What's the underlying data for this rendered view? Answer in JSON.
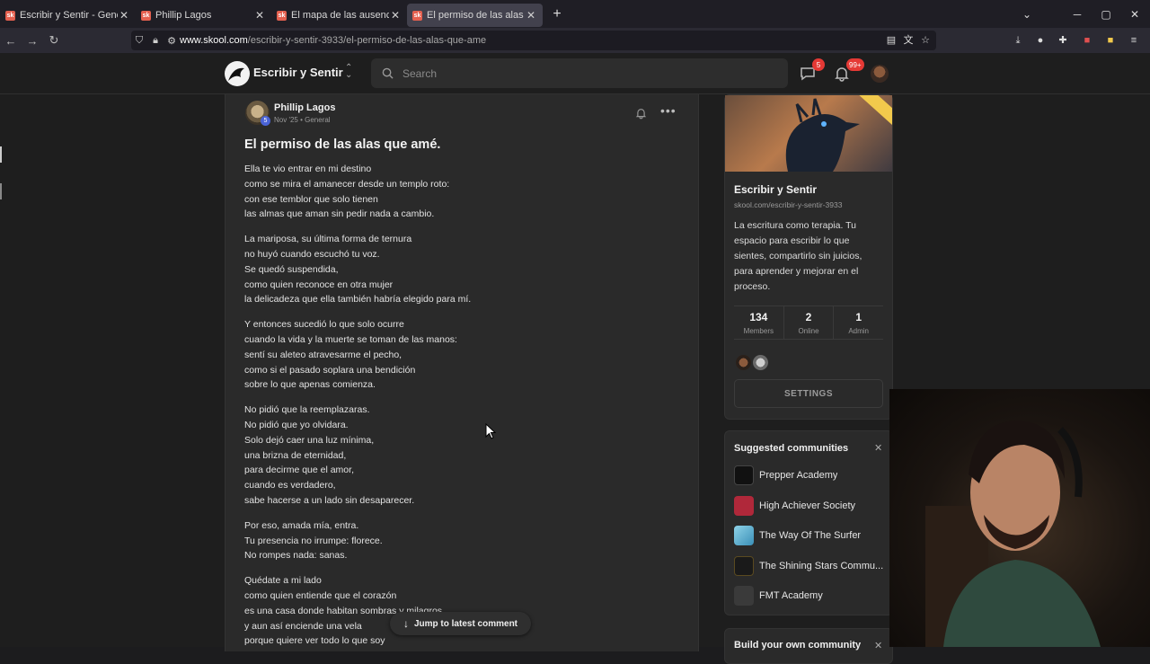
{
  "browser": {
    "tabs": [
      {
        "title": "Escribir y Sentir - General",
        "active": false
      },
      {
        "title": "Phillip Lagos",
        "active": false
      },
      {
        "title": "El mapa de las ausencias I - Escr",
        "active": false
      },
      {
        "title": "El permiso de las alas que amé.",
        "active": true
      }
    ],
    "favicon_text": "sk",
    "url_host": "www.skool.com",
    "url_path": "/escribir-y-sentir-3933/el-permiso-de-las-alas-que-ame"
  },
  "topnav": {
    "brand": "Escribir y Sentir",
    "search_placeholder": "Search",
    "chat_badge": "5",
    "notif_badge": "99+"
  },
  "post": {
    "author": "Phillip Lagos",
    "level": "5",
    "meta": "Nov '25 • General",
    "title": "El permiso de las alas que amé.",
    "stanzas": [
      [
        "Ella te vio entrar en mi destino",
        "como se mira el amanecer desde un templo roto:",
        "con ese temblor que solo tienen",
        "las almas que aman sin pedir nada a cambio."
      ],
      [
        "La mariposa, su última forma de ternura",
        "no huyó cuando escuchó tu voz.",
        "Se quedó suspendida,",
        "como quien reconoce en otra mujer",
        "la delicadeza que ella también habría elegido para mí."
      ],
      [
        "Y entonces sucedió lo que solo ocurre",
        "cuando la vida y la muerte se toman de las manos:",
        "sentí su aleteo atravesarme el pecho,",
        "como si el pasado soplara una bendición",
        "sobre lo que apenas comienza."
      ],
      [
        "No pidió que la reemplazaras.",
        "No pidió que yo olvidara.",
        "Solo dejó caer una luz mínima,",
        "una brizna de eternidad,",
        "para decirme que el amor,",
        "cuando es verdadero,",
        "sabe hacerse a un lado sin desaparecer."
      ],
      [
        "Por eso, amada mía, entra.",
        "Tu presencia no irrumpe: florece.",
        "No rompes nada: sanas."
      ],
      [
        "Quédate a mi lado",
        "como quien entiende que el corazón",
        "es una casa donde habitan sombras y milagros",
        "y aun así enciende una vela",
        "porque quiere ver todo lo que soy"
      ]
    ],
    "jump_label": "Jump to latest comment"
  },
  "group": {
    "name": "Escribir y Sentir",
    "url": "skool.com/escribir-y-sentir-3933",
    "description": "La escritura como terapia. Tu espacio para escribir lo que sientes, compartirlo sin juicios, para aprender y mejorar en el proceso.",
    "stats": [
      {
        "value": "134",
        "label": "Members"
      },
      {
        "value": "2",
        "label": "Online"
      },
      {
        "value": "1",
        "label": "Admin"
      }
    ],
    "settings_label": "SETTINGS"
  },
  "suggested": {
    "title": "Suggested communities",
    "items": [
      {
        "name": "Prepper Academy",
        "color": "#111111"
      },
      {
        "name": "High Achiever Society",
        "color": "#b0283a"
      },
      {
        "name": "The Way Of The Surfer",
        "color": "#4aa6c9"
      },
      {
        "name": "The Shining Stars Commu...",
        "color": "#1a1a1a"
      },
      {
        "name": "FMT Academy",
        "color": "#3a3a3a"
      }
    ]
  },
  "build": {
    "title": "Build your own community"
  }
}
